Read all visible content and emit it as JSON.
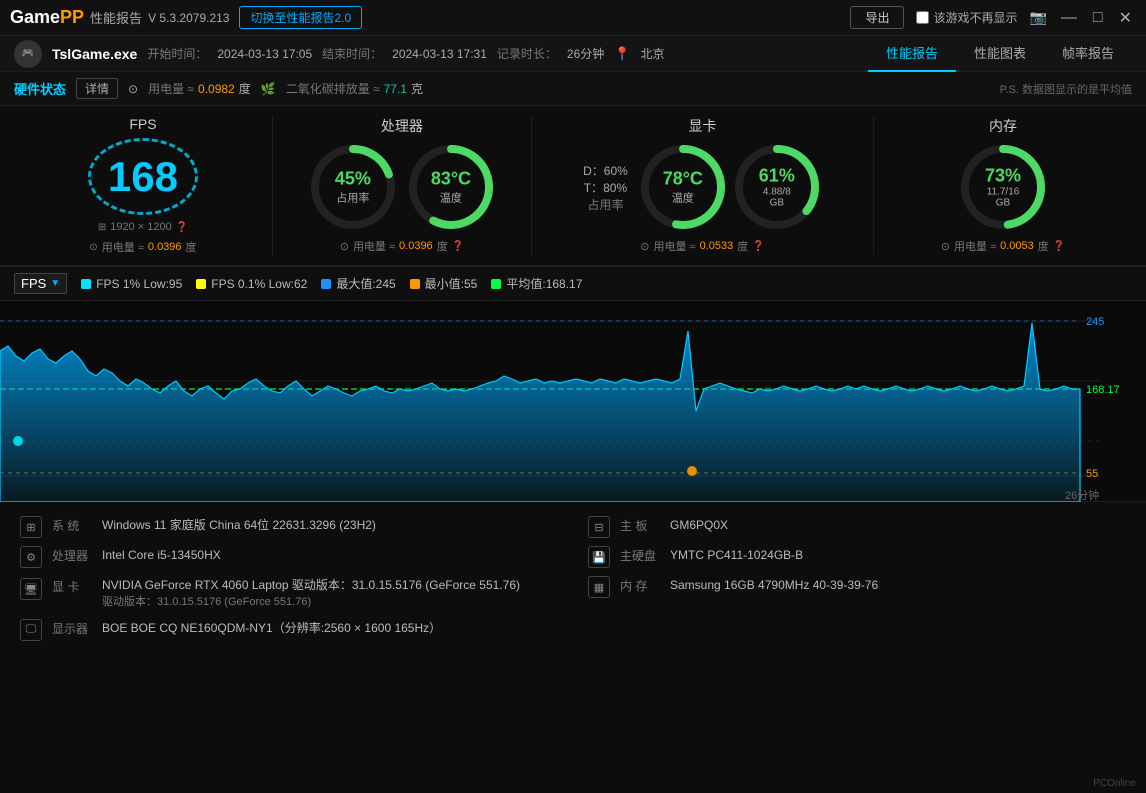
{
  "titlebar": {
    "logo_game": "Game",
    "logo_pp": "PP",
    "app_title": "性能报告",
    "version": "V 5.3.2079.213",
    "switch_btn": "切换至性能报告2.0",
    "export_btn": "导出",
    "no_show_label": "该游戏不再显示",
    "win_min": "—",
    "win_max": "□",
    "win_close": "✕"
  },
  "gameinfo": {
    "game_name": "TslGame.exe",
    "start_label": "开始时间：",
    "start_time": "2024-03-13 17:05",
    "end_label": "结束时间：",
    "end_time": "2024-03-13 17:31",
    "duration_label": "记录时长：",
    "duration": "26分钟",
    "location_icon": "📍",
    "location": "北京",
    "tabs": [
      "性能报告",
      "性能图表",
      "帧率报告"
    ],
    "active_tab": 0
  },
  "hwbar": {
    "title": "硬件状态",
    "detail_btn": "详情",
    "power_label": "用电量 ≈",
    "power_val": "0.0982",
    "power_unit": "度",
    "co2_icon": "🌿",
    "co2_label": "二氧化碳排放量 ≈",
    "co2_val": "77.1",
    "co2_unit": "克",
    "ps_note": "P.S. 数据图显示的是平均值"
  },
  "metrics": {
    "fps": {
      "title": "FPS",
      "value": "168",
      "resolution": "1920 × 1200",
      "power_label": "用电量 ≈",
      "power_val": "0.0396",
      "power_unit": "度"
    },
    "cpu": {
      "title": "处理器",
      "usage_val": "45%",
      "usage_label": "占用率",
      "temp_val": "83°C",
      "temp_label": "温度",
      "power_label": "用电量 ≈",
      "power_val": "0.0396",
      "power_unit": "度",
      "usage_color": "#4cd964",
      "temp_color": "#4cd964",
      "usage_pct": 45,
      "temp_pct": 83
    },
    "gpu": {
      "title": "显卡",
      "d_label": "D：60%",
      "t_label": "T：80%",
      "usage_label": "占用率",
      "temp_val": "78°C",
      "temp_label": "温度",
      "usage_val": "61%",
      "vram_label": "4.88/8 GB",
      "power_label": "用电量 ≈",
      "power_val": "0.0533",
      "power_unit": "度",
      "temp_pct": 78,
      "usage_pct": 61
    },
    "ram": {
      "title": "内存",
      "val": "73%",
      "label": "11.7/16 GB",
      "power_label": "用电量 ≈",
      "power_val": "0.0053",
      "power_unit": "度",
      "pct": 73
    }
  },
  "chart": {
    "selector_label": "FPS",
    "legend": [
      {
        "label": "FPS 1% Low:95",
        "color": "#00e5ff"
      },
      {
        "label": "FPS 0.1% Low:62",
        "color": "#ffff00"
      },
      {
        "label": "最大值:245",
        "color": "#1e90ff"
      },
      {
        "label": "最小值:55",
        "color": "#ff9900"
      },
      {
        "label": "平均值:168.17",
        "color": "#00ff44"
      }
    ],
    "max_val": 245,
    "avg_val": 168.17,
    "min_val": 55,
    "duration_label": "26分钟",
    "y_labels": [
      "245",
      "168.17",
      "55"
    ]
  },
  "sysinfo": {
    "left": [
      {
        "icon": "⊞",
        "label": "系 统",
        "val": "Windows 11 家庭版 China 64位 22631.3296 (23H2)"
      },
      {
        "icon": "⚙",
        "label": "处理器",
        "val": "Intel Core i5-13450HX"
      },
      {
        "icon": "🖥",
        "label": "显 卡",
        "val": "NVIDIA GeForce RTX 4060 Laptop\n驱动版本：31.0.15.5176 (GeForce 551.76)"
      },
      {
        "icon": "🖵",
        "label": "显示器",
        "val": "BOE BOE CQ NE160QDM-NY1（分辨率:2560 × 1600 165Hz）"
      }
    ],
    "right": [
      {
        "icon": "⊟",
        "label": "主 板",
        "val": "GM6PQ0X"
      },
      {
        "icon": "💾",
        "label": "主硬盘",
        "val": "YMTC PC411-1024GB-B"
      },
      {
        "icon": "▦",
        "label": "内 存",
        "val": "Samsung 16GB 4790MHz 40-39-39-76"
      }
    ]
  },
  "footer": {
    "pcoline": "PCOnline"
  }
}
